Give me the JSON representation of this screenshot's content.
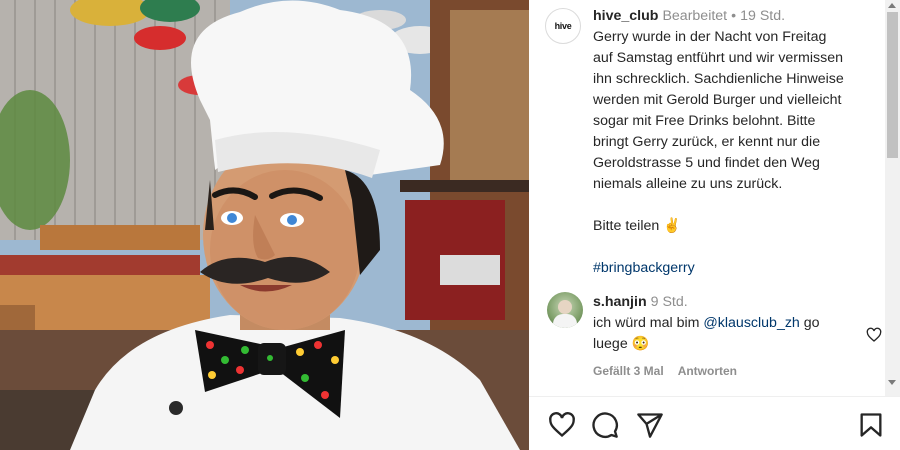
{
  "post": {
    "username": "hive_club",
    "avatar_text": "hive",
    "edited": "Bearbeitet",
    "separator": "•",
    "time": "19 Std.",
    "caption": "Gerry wurde in der Nacht von Freitag\nauf Samstag entführt und wir vermissen\nihn schrecklich. Sachdienliche Hinweise\nwerden mit Gerold Burger und vielleicht\nsogar mit Free Drinks belohnt. Bitte\nbringt Gerry zurück, er kennt nur die\nGeroldstrasse 5 und findet den Weg\nniemals alleine zu uns zurück.",
    "share_text": "Bitte teilen ✌️",
    "hashtag": "#bringbackgerry"
  },
  "comment": {
    "username": "s.hanjin",
    "time": "9 Std.",
    "text_before": "ich würd mal bim ",
    "mention": "@klausclub_zh",
    "text_after": " go luege 😳",
    "likes": "Gefällt 3 Mal",
    "reply": "Antworten"
  },
  "icons": {
    "like": "heart-icon",
    "comment": "comment-icon",
    "share": "send-icon",
    "save": "bookmark-icon",
    "comment_like": "heart-icon"
  },
  "colors": {
    "link": "#00376b",
    "muted": "#8e8e8e",
    "text": "#262626"
  }
}
